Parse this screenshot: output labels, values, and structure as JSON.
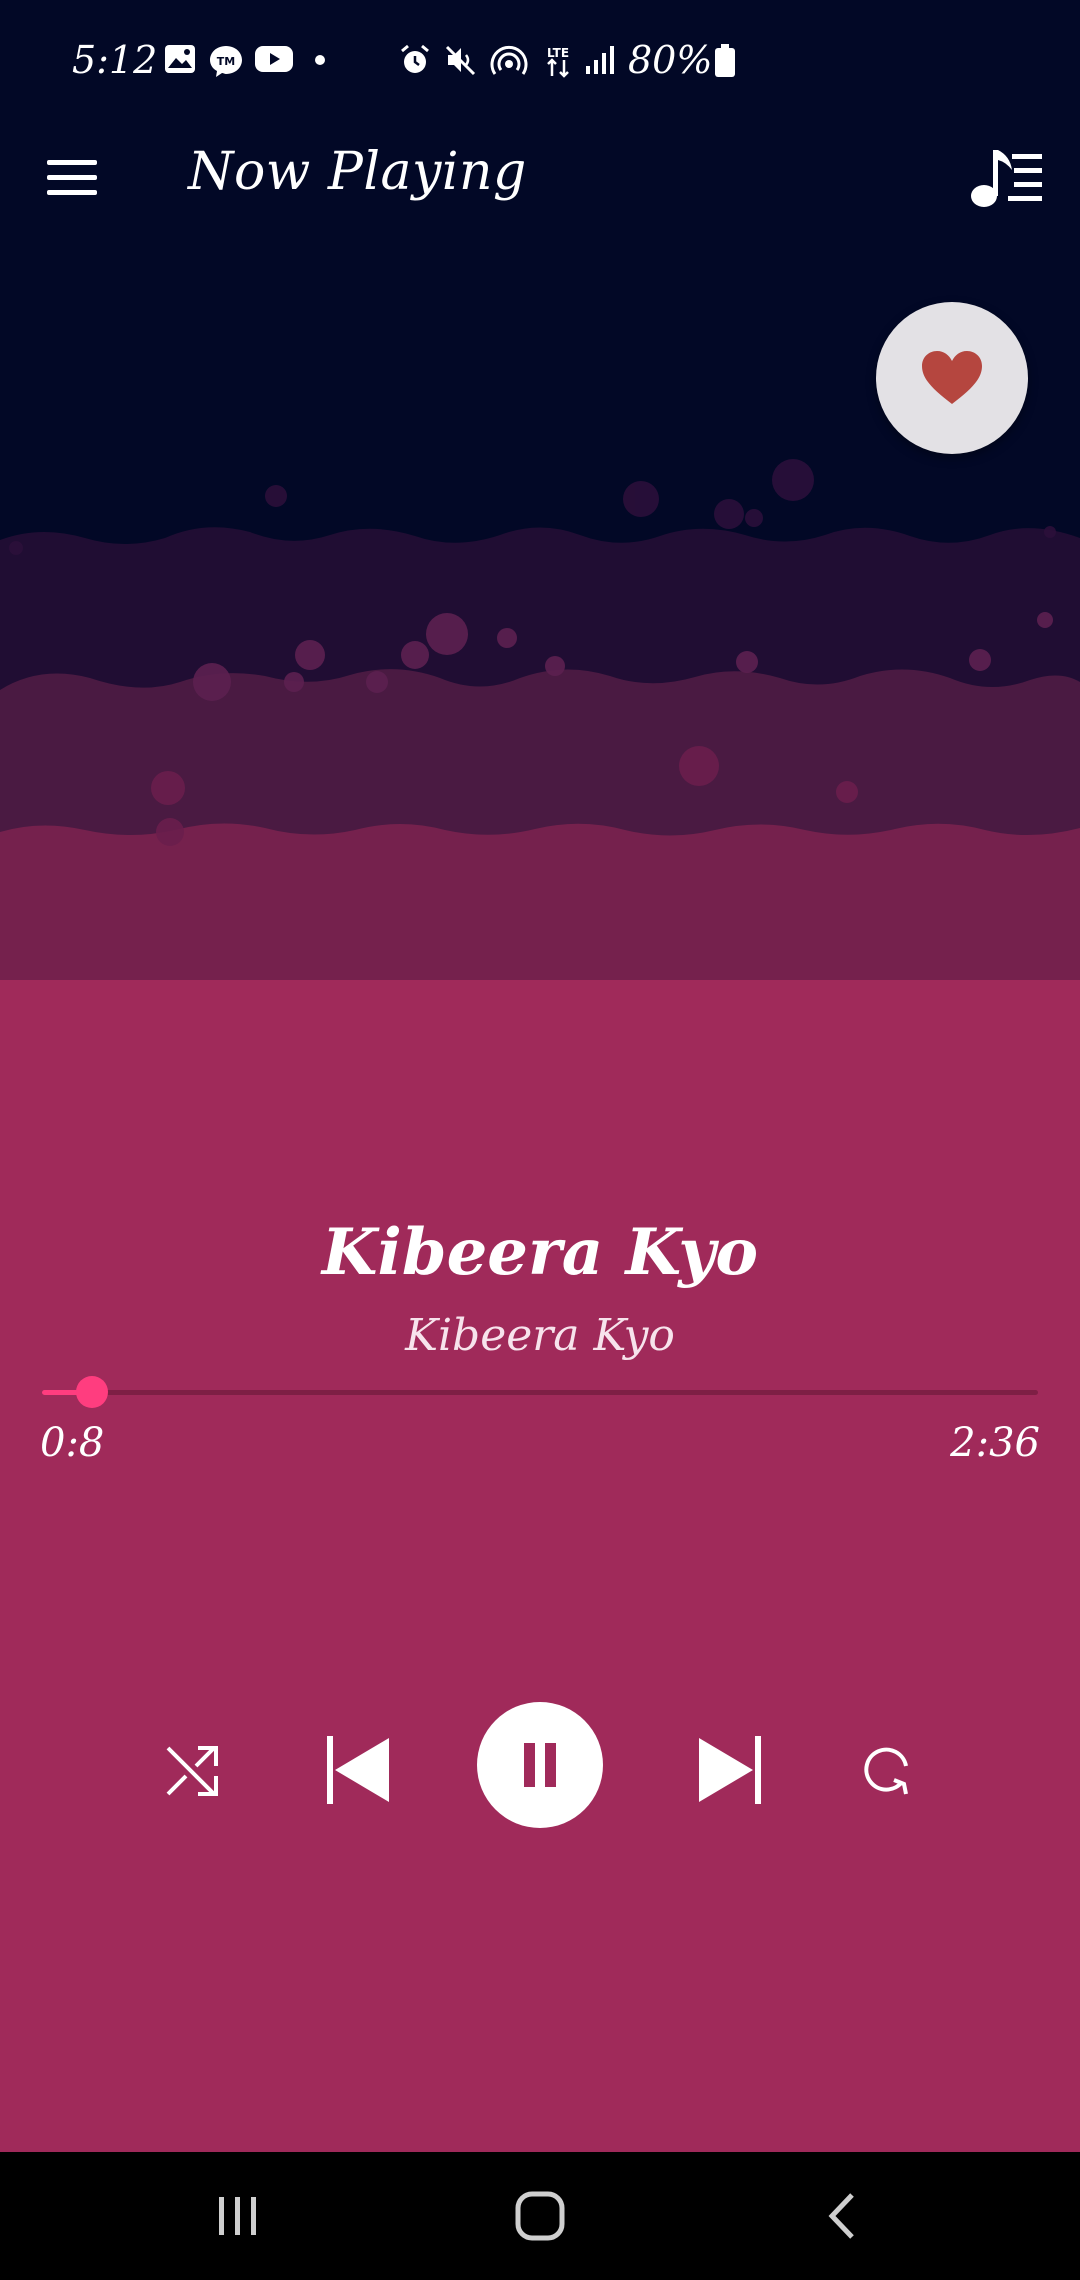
{
  "status_bar": {
    "time": "5:12",
    "battery": "80%",
    "icons": [
      "gallery-icon",
      "messenger-icon",
      "youtube-icon",
      "dot-icon",
      "alarm-icon",
      "mute-icon",
      "hotspot-icon",
      "lte-icon",
      "signal-icon",
      "battery-icon"
    ]
  },
  "header": {
    "title": "Now Playing",
    "menu_icon": "hamburger-menu-icon",
    "queue_icon": "music-queue-icon"
  },
  "favorite": {
    "icon": "heart-icon",
    "active": true,
    "color": "#B5463F"
  },
  "track": {
    "title": "Kibeera Kyo",
    "artist": "Kibeera Kyo"
  },
  "progress": {
    "elapsed": "0:8",
    "total": "2:36",
    "fraction": 0.05
  },
  "controls": {
    "shuffle_icon": "shuffle-icon",
    "previous_icon": "skip-previous-icon",
    "play_pause_icon": "pause-icon",
    "next_icon": "skip-next-icon",
    "repeat_icon": "repeat-icon"
  },
  "nav_bar": {
    "recents_icon": "recents-icon",
    "home_icon": "home-icon",
    "back_icon": "back-icon"
  },
  "colors": {
    "top_background": "#020826",
    "main_background": "#A02A5A",
    "wave_1": "#200D33",
    "wave_2": "#4A1A42",
    "wave_3": "#75214D",
    "accent": "#FF3D7F"
  }
}
